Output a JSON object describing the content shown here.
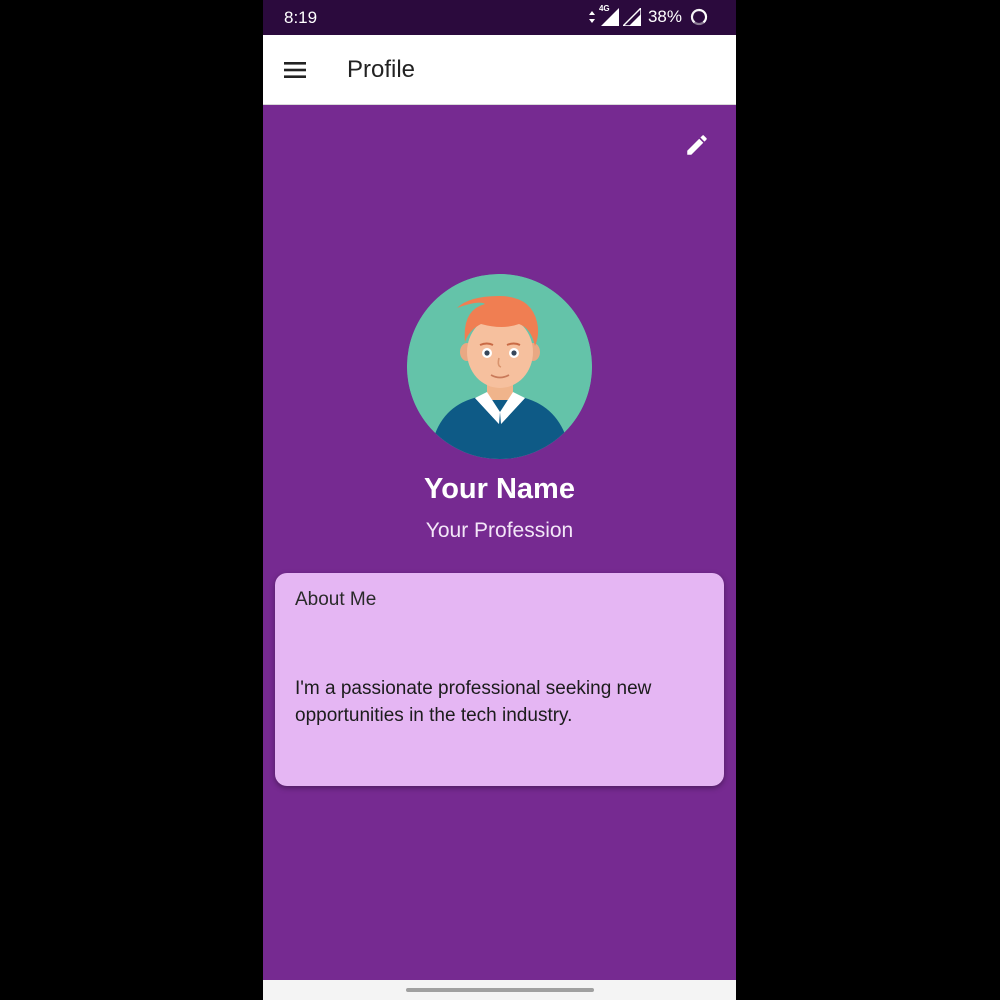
{
  "status_bar": {
    "time": "8:19",
    "network": "4G",
    "battery": "38%"
  },
  "app_bar": {
    "title": "Profile",
    "menu_icon": "hamburger-menu-icon"
  },
  "profile": {
    "edit_icon": "pencil-icon",
    "name": "Your Name",
    "profession": "Your Profession"
  },
  "about": {
    "title": "About Me",
    "text": "I'm a passionate professional seeking new opportunities in the tech industry."
  },
  "colors": {
    "background": "#762a91",
    "status_bar": "#2b0a3d",
    "card": "#e5b6f3",
    "avatar_bg": "#64c3a9"
  }
}
